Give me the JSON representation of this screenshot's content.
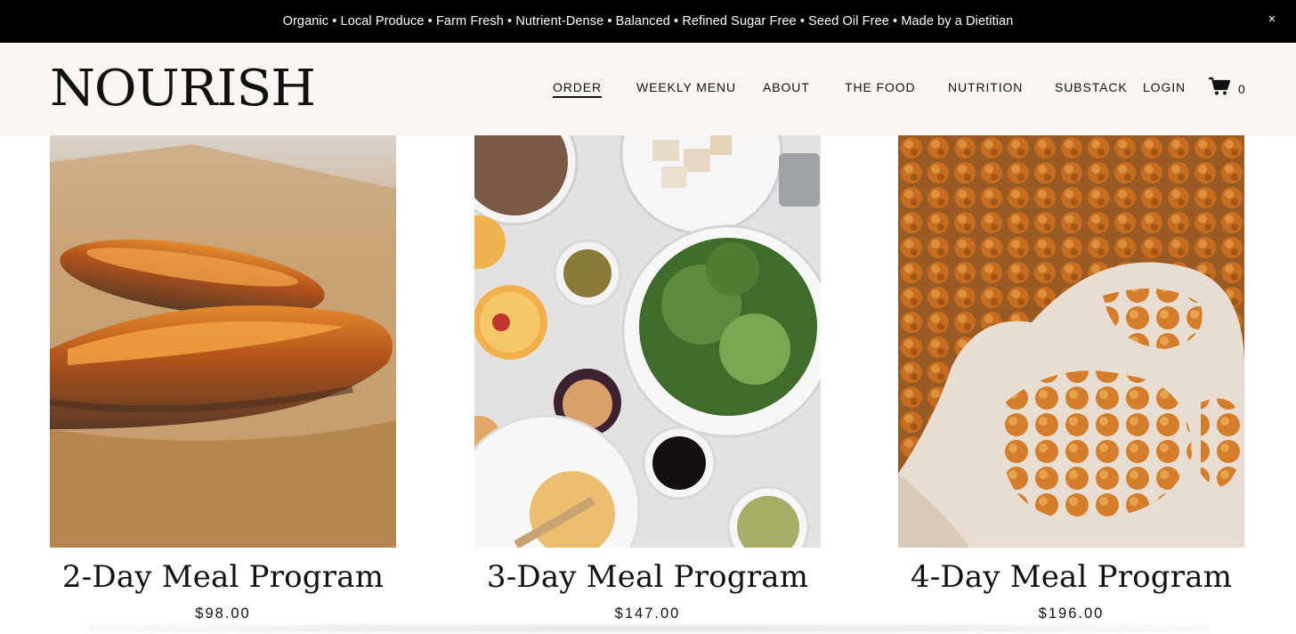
{
  "announcement": {
    "text": "Organic • Local Produce • Farm Fresh • Nutrient-Dense • Balanced • Refined Sugar Free • Seed Oil Free • Made by a Dietitian",
    "close": "×"
  },
  "header": {
    "logo": "NOURISH",
    "nav": [
      "ORDER",
      "WEEKLY MENU",
      "ABOUT",
      "THE FOOD",
      "NUTRITION",
      "SUBSTACK"
    ],
    "active_nav": "ORDER",
    "login": "LOGIN",
    "cart_count": "0"
  },
  "products": [
    {
      "title": "2-Day Meal Program",
      "price": "$98.00",
      "image_icon": "sweet-potato-image"
    },
    {
      "title": "3-Day Meal Program",
      "price": "$147.00",
      "image_icon": "salad-ingredients-image"
    },
    {
      "title": "4-Day Meal Program",
      "price": "$196.00",
      "image_icon": "roasted-chickpeas-image"
    }
  ],
  "colors": {
    "announcement_bg": "#000000",
    "header_bg": "#faf7f2",
    "text": "#111111"
  }
}
